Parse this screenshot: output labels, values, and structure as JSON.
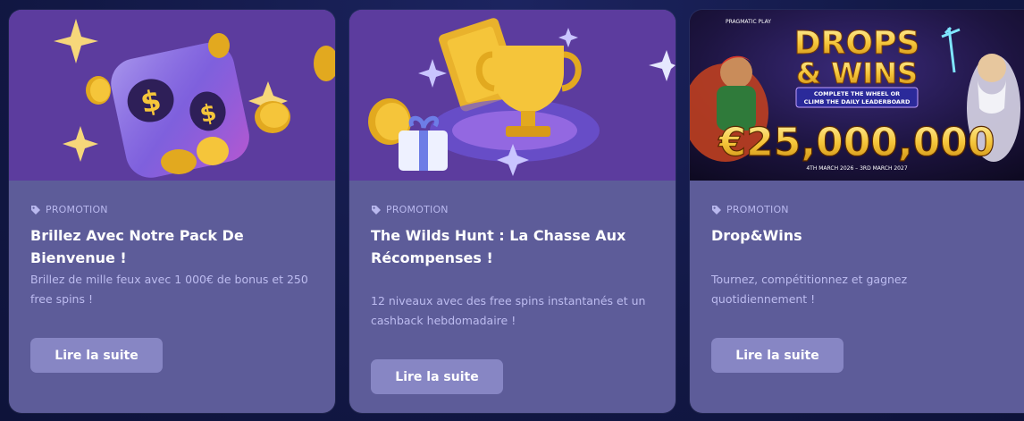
{
  "cards": [
    {
      "image_alt": "Welcome pack illustration",
      "tag": "PROMOTION",
      "title": "Brillez Avec Notre Pack De Bienvenue !",
      "description": "Brillez de mille feux avec 1 000€ de bonus et 250 free spins !",
      "button": "Lire la suite"
    },
    {
      "image_alt": "Trophy and gift illustration",
      "tag": "PROMOTION",
      "title": "The Wilds Hunt : La Chasse Aux Récompenses !",
      "description": "12 niveaux avec des free spins instantanés et un cashback hebdomadaire !",
      "button": "Lire la suite"
    },
    {
      "image_alt": "Drops & Wins banner",
      "tag": "PROMOTION",
      "title": "Drop&Wins",
      "description": "Tournez, compétitionnez et gagnez quotidiennement !",
      "button": "Lire la suite",
      "banner": {
        "brand": "PRAGMATIC PLAY",
        "heading_1": "DROPS",
        "heading_2": "& WINS",
        "subline_1": "COMPLETE THE WHEEL OR",
        "subline_2": "CLIMB THE DAILY LEADERBOARD",
        "amount": "€25,000,000",
        "dates": "4TH MARCH 2026 – 3RD MARCH 2027"
      }
    }
  ],
  "colors": {
    "page_bg": "#121845",
    "card_bg": "#5d5c99",
    "image_bg": "#5c3c9e",
    "button_bg": "#8786c4",
    "tag_text": "#b9b8ee",
    "desc_text": "#bdbcf0",
    "gold": "#f5c53a"
  },
  "icons": {
    "tag": "tag-icon"
  }
}
